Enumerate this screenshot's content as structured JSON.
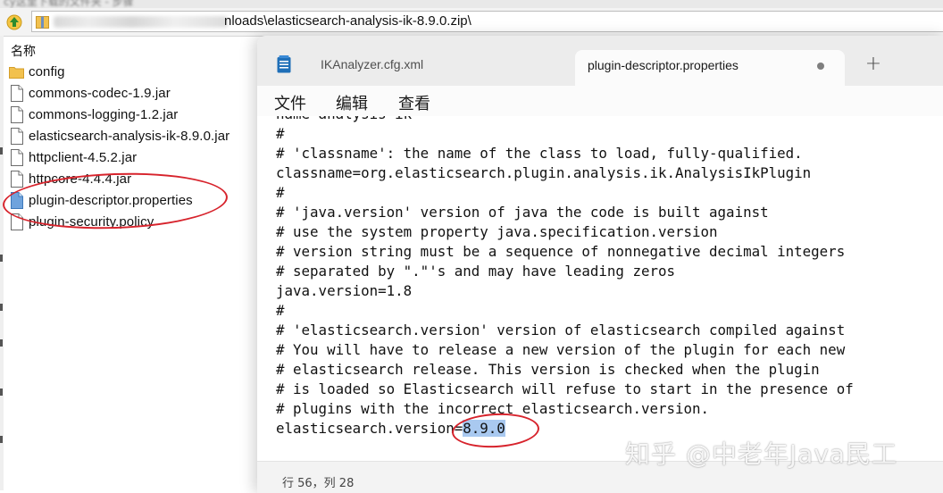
{
  "explorer": {
    "title_blurred": "cy这里下载的文件夹 - 步骤",
    "address": "nloads\\elasticsearch-analysis-ik-8.9.0.zip\\",
    "column_header": "名称",
    "files": [
      {
        "name": "config",
        "icon": "folder-icon"
      },
      {
        "name": "commons-codec-1.9.jar",
        "icon": "file-icon"
      },
      {
        "name": "commons-logging-1.2.jar",
        "icon": "file-icon"
      },
      {
        "name": "elasticsearch-analysis-ik-8.9.0.jar",
        "icon": "file-icon"
      },
      {
        "name": "httpclient-4.5.2.jar",
        "icon": "file-icon"
      },
      {
        "name": "httpcore-4.4.4.jar",
        "icon": "file-icon"
      },
      {
        "name": "plugin-descriptor.properties",
        "icon": "properties-file-icon"
      },
      {
        "name": "plugin-security.policy",
        "icon": "file-icon"
      }
    ]
  },
  "notepad": {
    "tabs": [
      {
        "label": "IKAnalyzer.cfg.xml",
        "active": false
      },
      {
        "label": "plugin-descriptor.properties",
        "active": true
      }
    ],
    "new_tab_label": "+",
    "menu": {
      "file": "文件",
      "edit": "编辑",
      "view": "查看"
    },
    "lines": [
      "name=analysis-ik",
      "#",
      "# 'classname': the name of the class to load, fully-qualified.",
      "classname=org.elasticsearch.plugin.analysis.ik.AnalysisIkPlugin",
      "#",
      "# 'java.version' version of java the code is built against",
      "# use the system property java.specification.version",
      "# version string must be a sequence of nonnegative decimal integers",
      "# separated by \".\"'s and may have leading zeros",
      "java.version=1.8",
      "#",
      "# 'elasticsearch.version' version of elasticsearch compiled against",
      "# You will have to release a new version of the plugin for each new",
      "# elasticsearch release. This version is checked when the plugin",
      "# is loaded so Elasticsearch will refuse to start in the presence of",
      "# plugins with the incorrect elasticsearch.version."
    ],
    "last_line_key": "elasticsearch.version=",
    "last_line_value": "8.9.0",
    "status": "行 56，列 28"
  },
  "watermark": "知乎 @中老年Java民工",
  "colors": {
    "highlight": "#a9c9f0",
    "annotation_red": "#d7232c",
    "folder": "#f2c14e"
  }
}
